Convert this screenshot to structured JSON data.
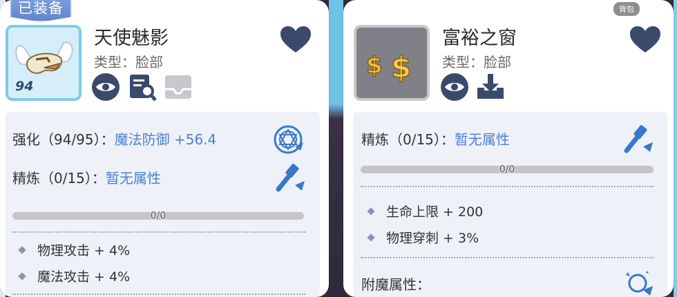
{
  "left_card": {
    "badge": "已装备",
    "item_level": "94",
    "item_name": "天使魅影",
    "item_type": "类型：脸部",
    "enhance_label": "强化（94/95）：",
    "enhance_value": "魔法防御 +56.4",
    "refine_label": "精炼（0/15）：",
    "refine_value": "暂无属性",
    "progress_text": "0/0",
    "progress_fraction": 0,
    "attributes": [
      "物理攻击 + 4%",
      "魔法攻击 + 4%"
    ]
  },
  "right_card": {
    "bag_tag": "背包",
    "item_name": "富裕之窗",
    "item_type": "类型：脸部",
    "refine_label": "精炼（0/15）：",
    "refine_value": "暂无属性",
    "progress_text": "0/0",
    "progress_fraction": 0,
    "attributes": [
      "生命上限 + 200",
      "物理穿刺 + 3%"
    ],
    "enchant_label": "附魔属性："
  },
  "colors": {
    "accent_blue": "#4f7ed0",
    "heart": "#3b4a6b",
    "panel_bg": "#eef1f7"
  },
  "icons": [
    "heart-icon",
    "eye-icon",
    "inspect-icon",
    "tray-icon",
    "hammer-icon",
    "enhance-emblem-icon",
    "download-icon",
    "enchant-icon"
  ]
}
